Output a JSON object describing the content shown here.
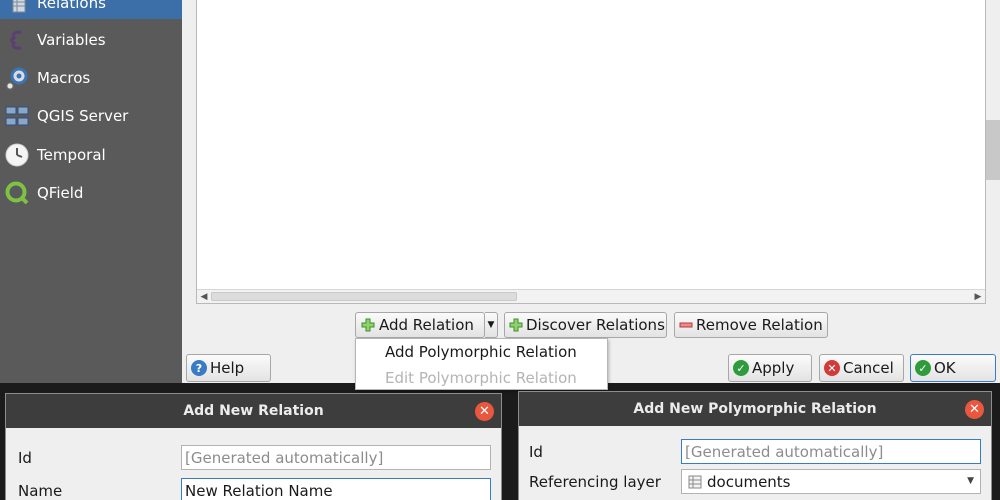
{
  "sidebar": {
    "items": [
      {
        "label": "Relations",
        "icon": "relations-icon"
      },
      {
        "label": "Variables",
        "icon": "variables-icon"
      },
      {
        "label": "Macros",
        "icon": "macros-icon"
      },
      {
        "label": "QGIS Server",
        "icon": "qgis-server-icon"
      },
      {
        "label": "Temporal",
        "icon": "temporal-icon"
      },
      {
        "label": "QField",
        "icon": "qfield-icon"
      }
    ]
  },
  "relations": {
    "add_label": "Add Relation",
    "discover_label": "Discover Relations",
    "remove_label": "Remove Relation",
    "menu": {
      "add_polymorphic": "Add Polymorphic Relation",
      "edit_polymorphic": "Edit Polymorphic Relation"
    }
  },
  "footer": {
    "help_label": "Help",
    "apply_label": "Apply",
    "cancel_label": "Cancel",
    "ok_label": "OK"
  },
  "add_relation_dialog": {
    "title": "Add New Relation",
    "id_label": "Id",
    "id_placeholder": "[Generated automatically]",
    "name_label": "Name",
    "name_value": "New Relation Name"
  },
  "add_polymorphic_dialog": {
    "title": "Add New Polymorphic Relation",
    "id_label": "Id",
    "id_placeholder": "[Generated automatically]",
    "referencing_layer_label": "Referencing layer",
    "referencing_layer_value": "documents"
  },
  "colors": {
    "sidebar_bg": "#5a5a5a",
    "selected_bg": "#3c6fa8",
    "title_bar": "#3d3d3d",
    "close_button": "#e9573e",
    "focus_border": "#3a7cc4"
  }
}
